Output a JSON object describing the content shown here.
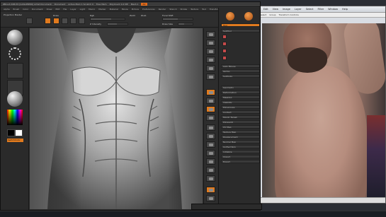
{
  "zbrush": {
    "title_text": "ZBrush 4R6 P2 [GUILLERMO] Artist Document",
    "title_segments": [
      "Document",
      "Active Mem 1 Scratch 0",
      "Free Mem",
      "PolyCount 1.0 MP",
      "Mesh 1"
    ],
    "title_tag": "AC",
    "menu": [
      "Alpha",
      "Brush",
      "Color",
      "Document",
      "Draw",
      "Edit",
      "File",
      "Layer",
      "Light",
      "Macro",
      "Marker",
      "Material",
      "Movie",
      "Picture",
      "Preferences",
      "Render",
      "Stencil",
      "Stroke",
      "Texture",
      "Tool",
      "Transform",
      "Zplugin",
      "Zscript"
    ],
    "shelf": {
      "left_label": "Projection Master",
      "draw_label": "Draw",
      "rgb_label": "Rgb",
      "zadd_label": "Zadd",
      "zsub_label": "Zsub",
      "focal_label": "Focal Shift",
      "intensity_label": "Z Intensity",
      "draw_size_label": "Draw Size"
    },
    "left_tray": {
      "switch_label": "SwitchColor"
    },
    "palette": {
      "tool_label": "Tool",
      "subtool_label": "SubTool",
      "geometry_label": "Geometry",
      "rows": [
        "Lazy Mouse",
        "Gizmo",
        "Subtools",
        "Deformation",
        "Masking",
        "Visibility",
        "Polygroups",
        "Contact",
        "Morph Target",
        "Polypaint",
        "UV Map",
        "Texture Map",
        "Displacement",
        "Normal Map",
        "Unified Skin",
        "Initialize",
        "Import",
        "Export"
      ]
    }
  },
  "photo_viewer": {
    "title_segments": [
      "File",
      "Edit",
      "View",
      "Image",
      "Layer",
      "Select",
      "Filter",
      "Window",
      "Help"
    ],
    "toolbar_segments": [
      "Auto-Select",
      "Group",
      "Transform Controls"
    ]
  }
}
